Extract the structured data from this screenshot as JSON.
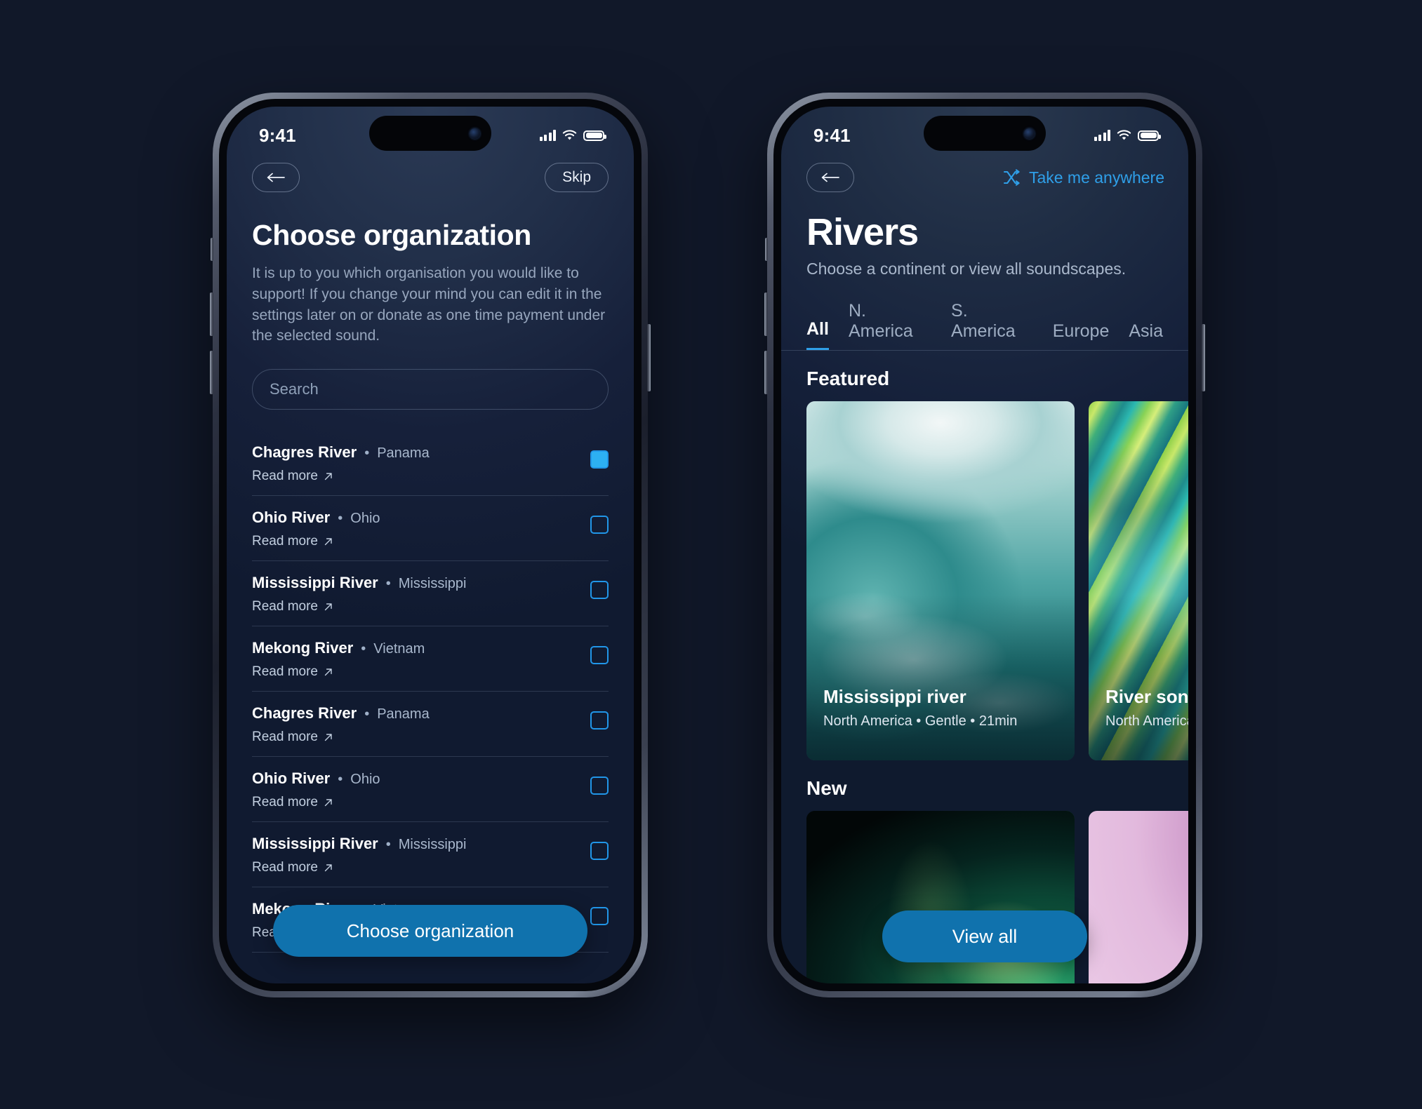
{
  "background_color": "#111829",
  "accent_color": "#1072ad",
  "link_color": "#2f9fe8",
  "checkbox_color": "#2196e8",
  "left_phone": {
    "status_bar": {
      "time": "9:41",
      "signal_icon": "cellular-bars-icon",
      "wifi_icon": "wifi-icon",
      "battery_icon": "battery-icon"
    },
    "nav": {
      "back_label": "←",
      "skip_label": "Skip"
    },
    "title": "Choose organization",
    "description": "It is up to you which organisation you would like to support! If you change your mind you can edit it in the settings later on or donate as one time payment under the selected sound.",
    "search": {
      "placeholder": "Search",
      "value": ""
    },
    "read_more_label": "Read more",
    "separator": "•",
    "organizations": [
      {
        "name": "Chagres River",
        "location": "Panama",
        "checked": true
      },
      {
        "name": "Ohio River",
        "location": "Ohio",
        "checked": false
      },
      {
        "name": "Mississippi River",
        "location": "Mississippi",
        "checked": false
      },
      {
        "name": "Mekong River",
        "location": "Vietnam",
        "checked": false
      },
      {
        "name": "Chagres River",
        "location": "Panama",
        "checked": false
      },
      {
        "name": "Ohio River",
        "location": "Ohio",
        "checked": false
      },
      {
        "name": "Mississippi River",
        "location": "Mississippi",
        "checked": false
      },
      {
        "name": "Mekong River",
        "location": "Vietnam",
        "checked": false
      }
    ],
    "cta_label": "Choose organization"
  },
  "right_phone": {
    "status_bar": {
      "time": "9:41",
      "signal_icon": "cellular-bars-icon",
      "wifi_icon": "wifi-icon",
      "battery_icon": "battery-icon"
    },
    "nav": {
      "back_label": "←",
      "shuffle_label": "Take me anywhere",
      "shuffle_icon": "shuffle-icon"
    },
    "title": "Rivers",
    "subtitle": "Choose a continent or view all soundscapes.",
    "tabs": [
      {
        "label": "All",
        "active": true
      },
      {
        "label": "N. America",
        "active": false
      },
      {
        "label": "S. America",
        "active": false
      },
      {
        "label": "Europe",
        "active": false
      },
      {
        "label": "Asia",
        "active": false
      }
    ],
    "sections": [
      {
        "heading": "Featured",
        "cards": [
          {
            "title": "Mississippi river",
            "meta": "North America • Gentle • 21min"
          },
          {
            "title": "River song",
            "meta": "North America"
          }
        ]
      },
      {
        "heading": "New",
        "cards": [
          {
            "title": "",
            "meta": ""
          },
          {
            "title": "",
            "meta": ""
          }
        ]
      }
    ],
    "cta_label": "View all"
  }
}
